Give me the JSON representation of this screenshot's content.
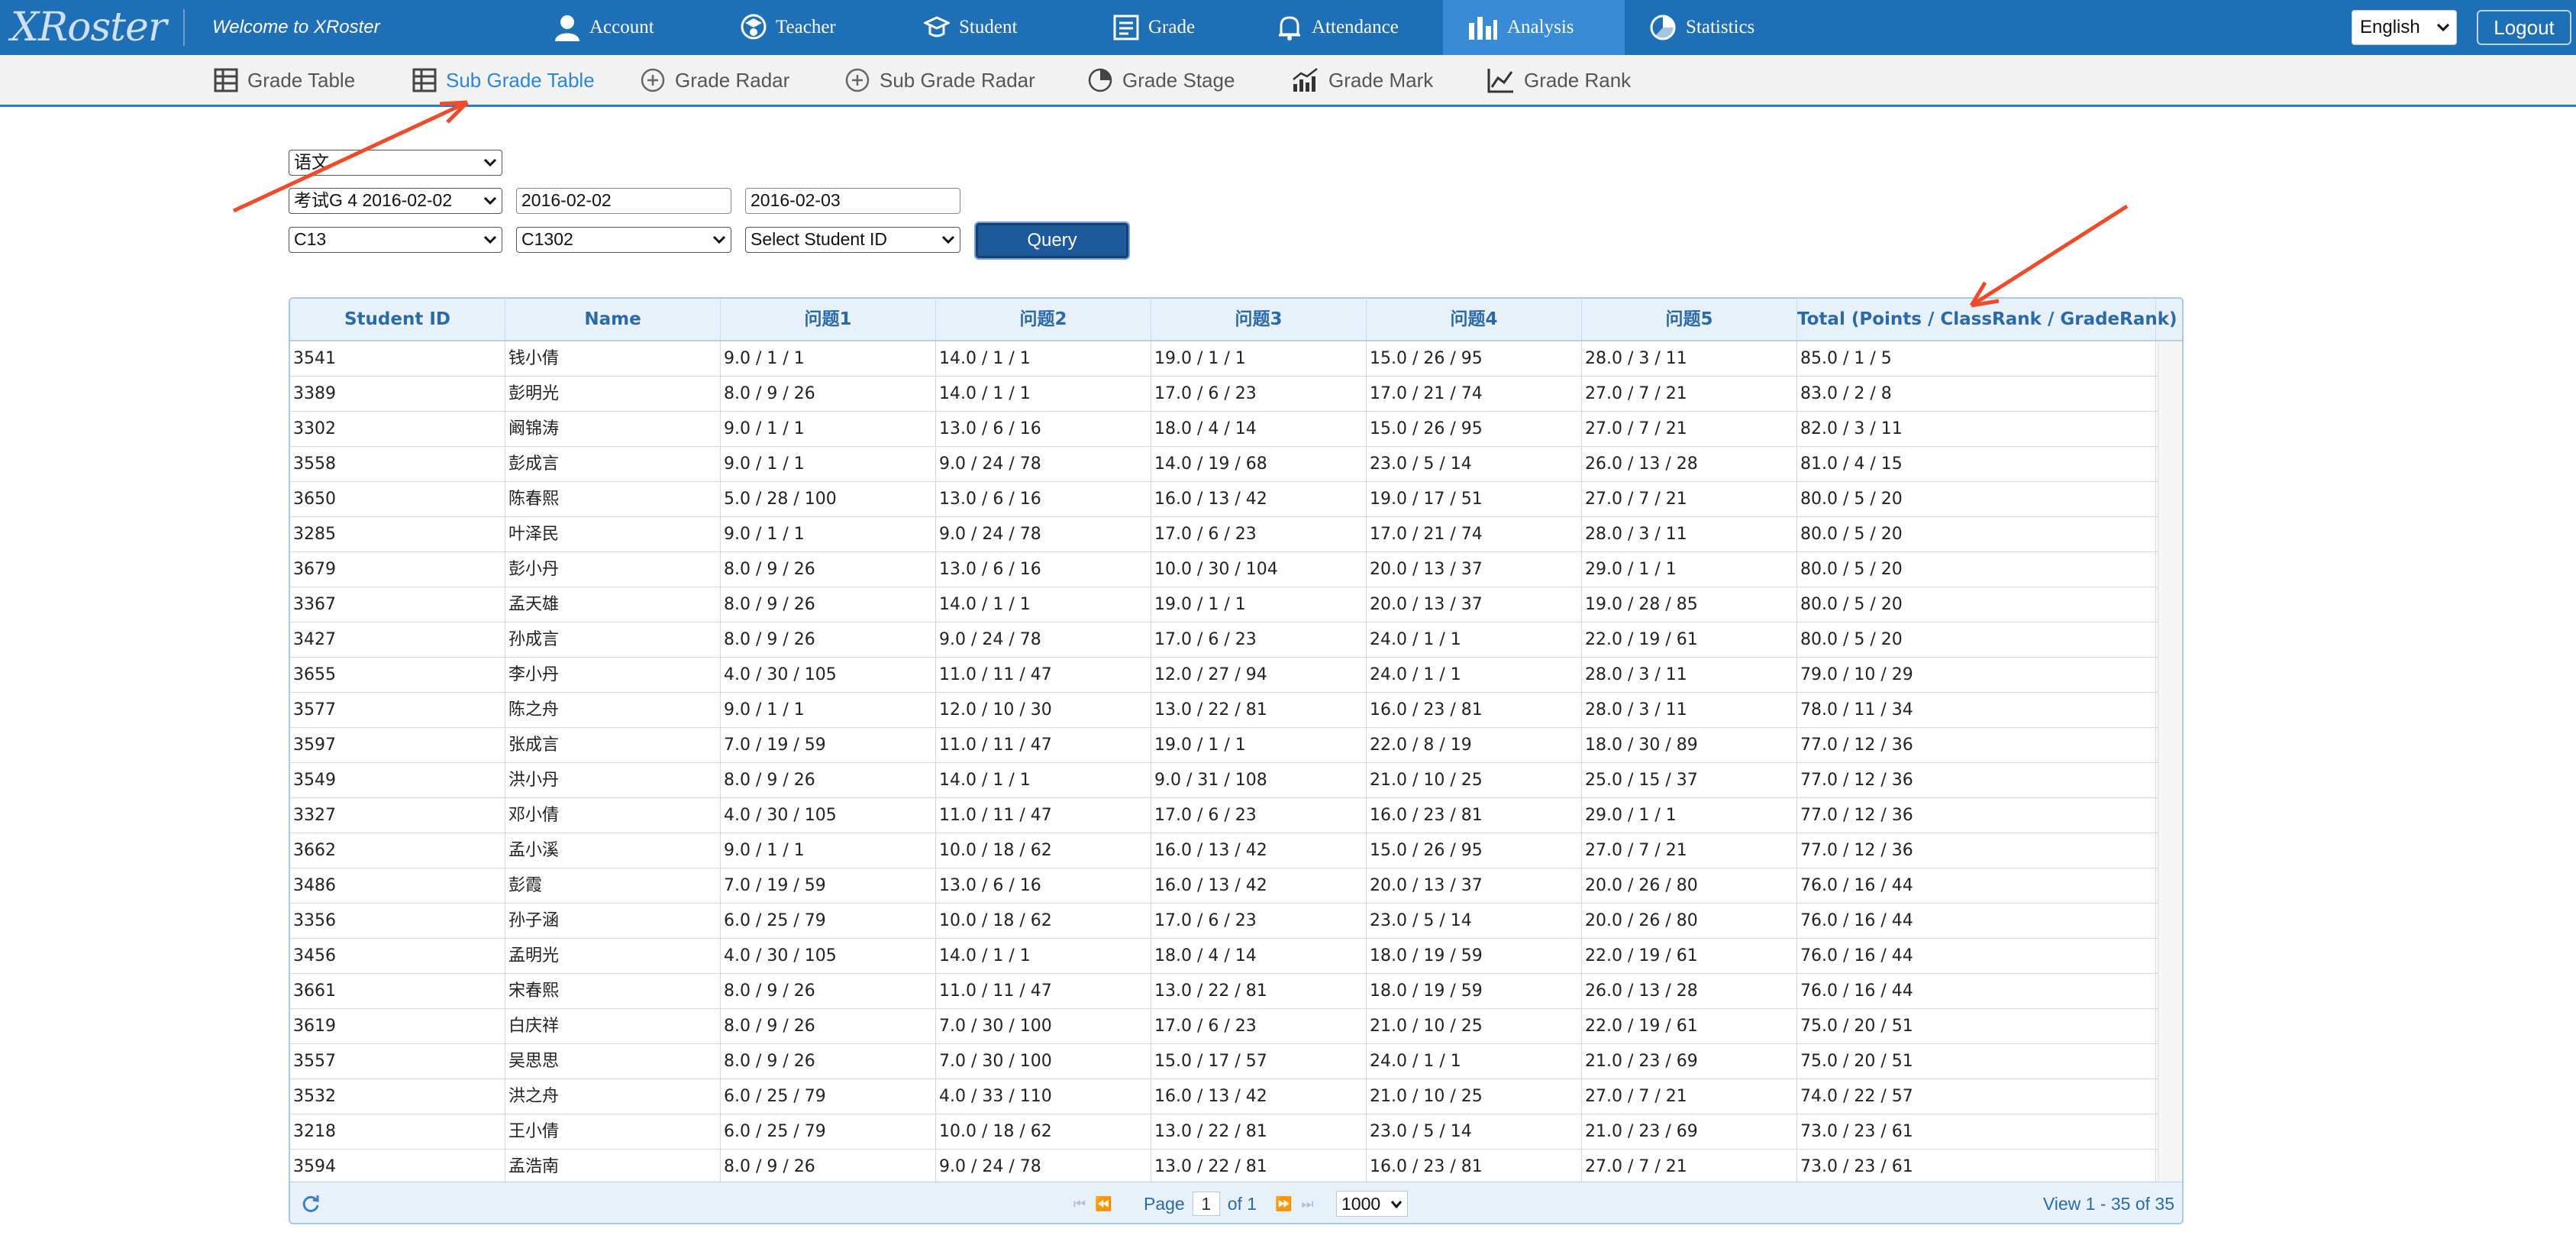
{
  "app": {
    "logo": "XRoster",
    "welcome": "Welcome to XRoster",
    "language": "English",
    "logout": "Logout"
  },
  "nav": [
    {
      "label": "Account",
      "icon": "user-icon"
    },
    {
      "label": "Teacher",
      "icon": "teacher-icon"
    },
    {
      "label": "Student",
      "icon": "student-icon"
    },
    {
      "label": "Grade",
      "icon": "grade-icon"
    },
    {
      "label": "Attendance",
      "icon": "bell-icon"
    },
    {
      "label": "Analysis",
      "icon": "bar-chart-icon",
      "active": true
    },
    {
      "label": "Statistics",
      "icon": "pie-chart-icon"
    }
  ],
  "subnav": [
    {
      "label": "Grade Table",
      "icon": "table-icon"
    },
    {
      "label": "Sub Grade Table",
      "icon": "table-icon",
      "active": true
    },
    {
      "label": "Grade Radar",
      "icon": "radar-icon"
    },
    {
      "label": "Sub Grade Radar",
      "icon": "radar-icon"
    },
    {
      "label": "Grade Stage",
      "icon": "pie-icon"
    },
    {
      "label": "Grade Mark",
      "icon": "mark-chart-icon"
    },
    {
      "label": "Grade Rank",
      "icon": "rank-chart-icon"
    }
  ],
  "filters": {
    "subject": "语文",
    "exam": "考试G 4 2016-02-02",
    "start_date": "2016-02-02",
    "end_date": "2016-02-03",
    "grade": "C13",
    "class": "C1302",
    "student": "Select Student ID",
    "query": "Query"
  },
  "table": {
    "columns": [
      "Student ID",
      "Name",
      "问题1",
      "问题2",
      "问题3",
      "问题4",
      "问题5",
      "Total (Points / ClassRank / GradeRank)"
    ],
    "rows": [
      [
        "3541",
        "钱小倩",
        "9.0 / 1 / 1",
        "14.0 / 1 / 1",
        "19.0 / 1 / 1",
        "15.0 / 26 / 95",
        "28.0 / 3 / 11",
        "85.0 / 1 / 5"
      ],
      [
        "3389",
        "彭明光",
        "8.0 / 9 / 26",
        "14.0 / 1 / 1",
        "17.0 / 6 / 23",
        "17.0 / 21 / 74",
        "27.0 / 7 / 21",
        "83.0 / 2 / 8"
      ],
      [
        "3302",
        "阚锦涛",
        "9.0 / 1 / 1",
        "13.0 / 6 / 16",
        "18.0 / 4 / 14",
        "15.0 / 26 / 95",
        "27.0 / 7 / 21",
        "82.0 / 3 / 11"
      ],
      [
        "3558",
        "彭成言",
        "9.0 / 1 / 1",
        "9.0 / 24 / 78",
        "14.0 / 19 / 68",
        "23.0 / 5 / 14",
        "26.0 / 13 / 28",
        "81.0 / 4 / 15"
      ],
      [
        "3650",
        "陈春熙",
        "5.0 / 28 / 100",
        "13.0 / 6 / 16",
        "16.0 / 13 / 42",
        "19.0 / 17 / 51",
        "27.0 / 7 / 21",
        "80.0 / 5 / 20"
      ],
      [
        "3285",
        "叶泽民",
        "9.0 / 1 / 1",
        "9.0 / 24 / 78",
        "17.0 / 6 / 23",
        "17.0 / 21 / 74",
        "28.0 / 3 / 11",
        "80.0 / 5 / 20"
      ],
      [
        "3679",
        "彭小丹",
        "8.0 / 9 / 26",
        "13.0 / 6 / 16",
        "10.0 / 30 / 104",
        "20.0 / 13 / 37",
        "29.0 / 1 / 1",
        "80.0 / 5 / 20"
      ],
      [
        "3367",
        "孟天雄",
        "8.0 / 9 / 26",
        "14.0 / 1 / 1",
        "19.0 / 1 / 1",
        "20.0 / 13 / 37",
        "19.0 / 28 / 85",
        "80.0 / 5 / 20"
      ],
      [
        "3427",
        "孙成言",
        "8.0 / 9 / 26",
        "9.0 / 24 / 78",
        "17.0 / 6 / 23",
        "24.0 / 1 / 1",
        "22.0 / 19 / 61",
        "80.0 / 5 / 20"
      ],
      [
        "3655",
        "李小丹",
        "4.0 / 30 / 105",
        "11.0 / 11 / 47",
        "12.0 / 27 / 94",
        "24.0 / 1 / 1",
        "28.0 / 3 / 11",
        "79.0 / 10 / 29"
      ],
      [
        "3577",
        "陈之舟",
        "9.0 / 1 / 1",
        "12.0 / 10 / 30",
        "13.0 / 22 / 81",
        "16.0 / 23 / 81",
        "28.0 / 3 / 11",
        "78.0 / 11 / 34"
      ],
      [
        "3597",
        "张成言",
        "7.0 / 19 / 59",
        "11.0 / 11 / 47",
        "19.0 / 1 / 1",
        "22.0 / 8 / 19",
        "18.0 / 30 / 89",
        "77.0 / 12 / 36"
      ],
      [
        "3549",
        "洪小丹",
        "8.0 / 9 / 26",
        "14.0 / 1 / 1",
        "9.0 / 31 / 108",
        "21.0 / 10 / 25",
        "25.0 / 15 / 37",
        "77.0 / 12 / 36"
      ],
      [
        "3327",
        "邓小倩",
        "4.0 / 30 / 105",
        "11.0 / 11 / 47",
        "17.0 / 6 / 23",
        "16.0 / 23 / 81",
        "29.0 / 1 / 1",
        "77.0 / 12 / 36"
      ],
      [
        "3662",
        "孟小溪",
        "9.0 / 1 / 1",
        "10.0 / 18 / 62",
        "16.0 / 13 / 42",
        "15.0 / 26 / 95",
        "27.0 / 7 / 21",
        "77.0 / 12 / 36"
      ],
      [
        "3486",
        "彭霞",
        "7.0 / 19 / 59",
        "13.0 / 6 / 16",
        "16.0 / 13 / 42",
        "20.0 / 13 / 37",
        "20.0 / 26 / 80",
        "76.0 / 16 / 44"
      ],
      [
        "3356",
        "孙子涵",
        "6.0 / 25 / 79",
        "10.0 / 18 / 62",
        "17.0 / 6 / 23",
        "23.0 / 5 / 14",
        "20.0 / 26 / 80",
        "76.0 / 16 / 44"
      ],
      [
        "3456",
        "孟明光",
        "4.0 / 30 / 105",
        "14.0 / 1 / 1",
        "18.0 / 4 / 14",
        "18.0 / 19 / 59",
        "22.0 / 19 / 61",
        "76.0 / 16 / 44"
      ],
      [
        "3661",
        "宋春熙",
        "8.0 / 9 / 26",
        "11.0 / 11 / 47",
        "13.0 / 22 / 81",
        "18.0 / 19 / 59",
        "26.0 / 13 / 28",
        "76.0 / 16 / 44"
      ],
      [
        "3619",
        "白庆祥",
        "8.0 / 9 / 26",
        "7.0 / 30 / 100",
        "17.0 / 6 / 23",
        "21.0 / 10 / 25",
        "22.0 / 19 / 61",
        "75.0 / 20 / 51"
      ],
      [
        "3557",
        "吴思思",
        "8.0 / 9 / 26",
        "7.0 / 30 / 100",
        "15.0 / 17 / 57",
        "24.0 / 1 / 1",
        "21.0 / 23 / 69",
        "75.0 / 20 / 51"
      ],
      [
        "3532",
        "洪之舟",
        "6.0 / 25 / 79",
        "4.0 / 33 / 110",
        "16.0 / 13 / 42",
        "21.0 / 10 / 25",
        "27.0 / 7 / 21",
        "74.0 / 22 / 57"
      ],
      [
        "3218",
        "王小倩",
        "6.0 / 25 / 79",
        "10.0 / 18 / 62",
        "13.0 / 22 / 81",
        "23.0 / 5 / 14",
        "21.0 / 23 / 69",
        "73.0 / 23 / 61"
      ],
      [
        "3594",
        "孟浩南",
        "8.0 / 9 / 26",
        "9.0 / 24 / 78",
        "13.0 / 22 / 81",
        "16.0 / 23 / 81",
        "27.0 / 7 / 21",
        "73.0 / 23 / 61"
      ]
    ]
  },
  "pager": {
    "page_label": "Page",
    "page": "1",
    "of_label": "of 1",
    "rows_per_page": "1000",
    "view_text": "View 1 - 35 of 35"
  }
}
